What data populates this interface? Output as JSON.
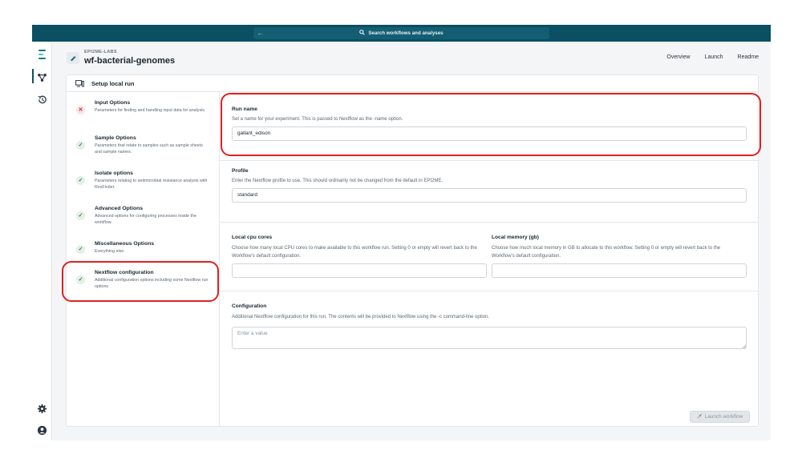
{
  "search": {
    "label": "Search workflows and analyses"
  },
  "header": {
    "org": "EPI2ME-LABS",
    "workflow": "wf-bacterial-genomes",
    "nav": [
      "Overview",
      "Launch",
      "Readme"
    ]
  },
  "card": {
    "title": "Setup local run"
  },
  "steps": [
    {
      "status": "error",
      "title": "Input Options",
      "desc": "Parameters for finding and handling input data for analysis."
    },
    {
      "status": "ok",
      "title": "Sample Options",
      "desc": "Parameters that relate to samples such as sample sheets and sample names."
    },
    {
      "status": "ok",
      "title": "Isolate options",
      "desc": "Parameters relating to antimicrobial resistance analysis with ResFinder."
    },
    {
      "status": "ok",
      "title": "Advanced Options",
      "desc": "Advanced options for configuring processes inside the workflow."
    },
    {
      "status": "ok",
      "title": "Miscellaneous Options",
      "desc": "Everything else."
    },
    {
      "status": "ok",
      "title": "Nextflow configuration",
      "desc": "Additional configuration options including some Nextflow run options"
    }
  ],
  "form": {
    "run_name": {
      "label": "Run name",
      "help": "Set a name for your experiment. This is passed to Nextflow as the -name option.",
      "value": "gallant_edison"
    },
    "profile": {
      "label": "Profile",
      "help": "Enter the Nextflow profile to use. This should ordinarily not be changed from the default in EPI2ME.",
      "value": "standard"
    },
    "cpu": {
      "label": "Local cpu cores",
      "help": "Choose how many local CPU cores to make available to this workflow run. Setting 0 or empty will revert back to the Workflow's default configuration.",
      "value": ""
    },
    "memory": {
      "label": "Local memory (gb)",
      "help": "Choose how much local memory in GB to allocate to this workflow. Setting 0 or empty will revert back to the Workflow's default configuration.",
      "value": ""
    },
    "config": {
      "label": "Configuration",
      "help": "Additional Nextflow configuration for this run. The contents will be provided to Nextflow using the -c command-line option.",
      "placeholder": "Enter a value"
    }
  },
  "launch_label": "Launch workflow",
  "colors": {
    "topbar": "#0b4f62",
    "highlight": "#e02020",
    "ok": "#2e8a45",
    "error": "#c53742"
  },
  "icons": [
    "back-arrow-icon",
    "search-icon",
    "epi2me-logo-icon",
    "workflows-icon",
    "history-icon",
    "settings-gear-icon",
    "user-account-icon",
    "project-icon",
    "monitor-icon",
    "check-icon",
    "x-icon",
    "rocket-icon",
    "resize-handle-icon"
  ]
}
